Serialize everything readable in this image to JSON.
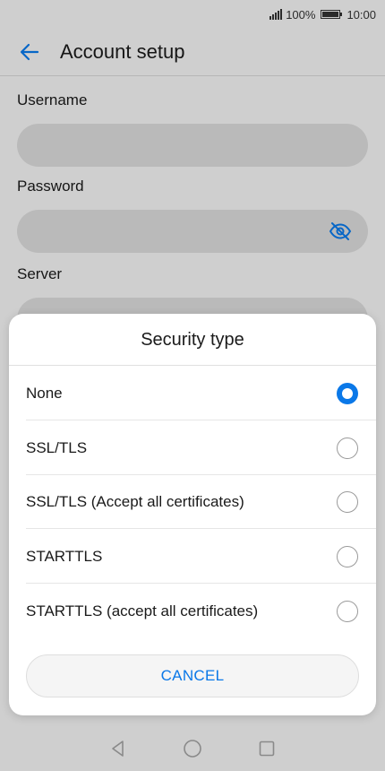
{
  "status_bar": {
    "battery_percent": "100%",
    "time": "10:00"
  },
  "app_bar": {
    "title": "Account setup",
    "back_icon": "back-arrow-icon"
  },
  "form": {
    "username_label": "Username",
    "password_label": "Password",
    "server_label": "Server",
    "password_icon": "eye-off-icon"
  },
  "dialog": {
    "title": "Security type",
    "options": [
      {
        "label": "None",
        "selected": true
      },
      {
        "label": "SSL/TLS",
        "selected": false
      },
      {
        "label": "SSL/TLS (Accept all certificates)",
        "selected": false
      },
      {
        "label": "STARTTLS",
        "selected": false
      },
      {
        "label": "STARTTLS (accept all certificates)",
        "selected": false
      }
    ],
    "cancel_label": "CANCEL"
  },
  "nav_bar": {
    "icons": [
      "back-triangle-icon",
      "home-circle-icon",
      "recents-square-icon"
    ]
  },
  "colors": {
    "accent": "#0a78e8",
    "input_bg": "#d9d9d9"
  }
}
